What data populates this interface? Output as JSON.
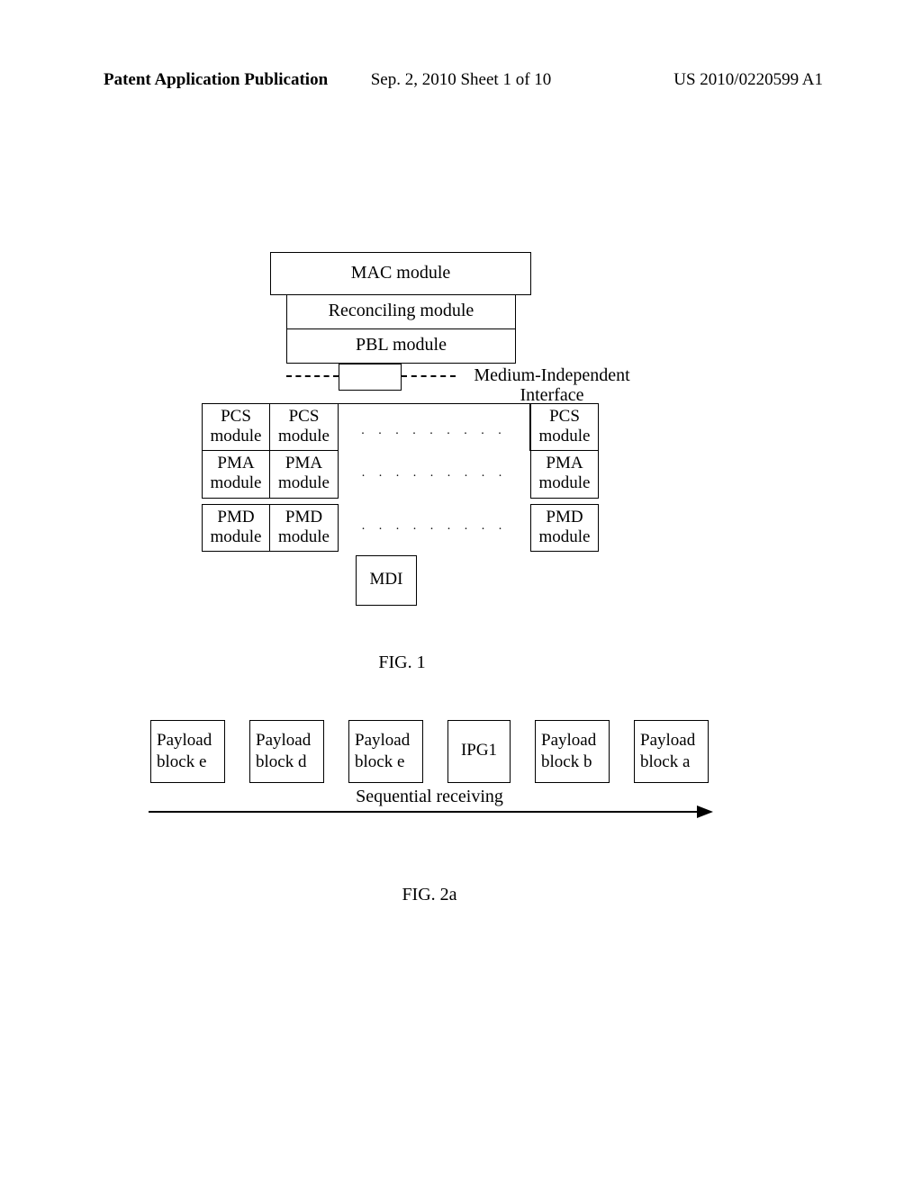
{
  "header": {
    "left": "Patent Application Publication",
    "center": "Sep. 2, 2010  Sheet 1 of 10",
    "right": "US 2010/0220599 A1"
  },
  "fig1": {
    "mac": "MAC module",
    "reconciling": "Reconciling module",
    "pbl": "PBL module",
    "mii_label": "Medium-Independent Interface",
    "col1": {
      "pcs": "PCS module",
      "pma": "PMA module",
      "pmd": "PMD module"
    },
    "col2": {
      "pcs": "PCS module",
      "pma": "PMA module",
      "pmd": "PMD module"
    },
    "col3": {
      "pcs": "PCS module",
      "pma": "PMA module",
      "pmd": "PMD module"
    },
    "dots": ". . . . . . . . .",
    "mdi": "MDI",
    "caption": "FIG. 1"
  },
  "fig2a": {
    "blocks": [
      {
        "label": "Payload block e"
      },
      {
        "label": "Payload block d"
      },
      {
        "label": "Payload block e"
      },
      {
        "label": "IPG1"
      },
      {
        "label": "Payload block b"
      },
      {
        "label": "Payload block a"
      }
    ],
    "seq_label": "Sequential receiving",
    "caption": "FIG. 2a"
  }
}
